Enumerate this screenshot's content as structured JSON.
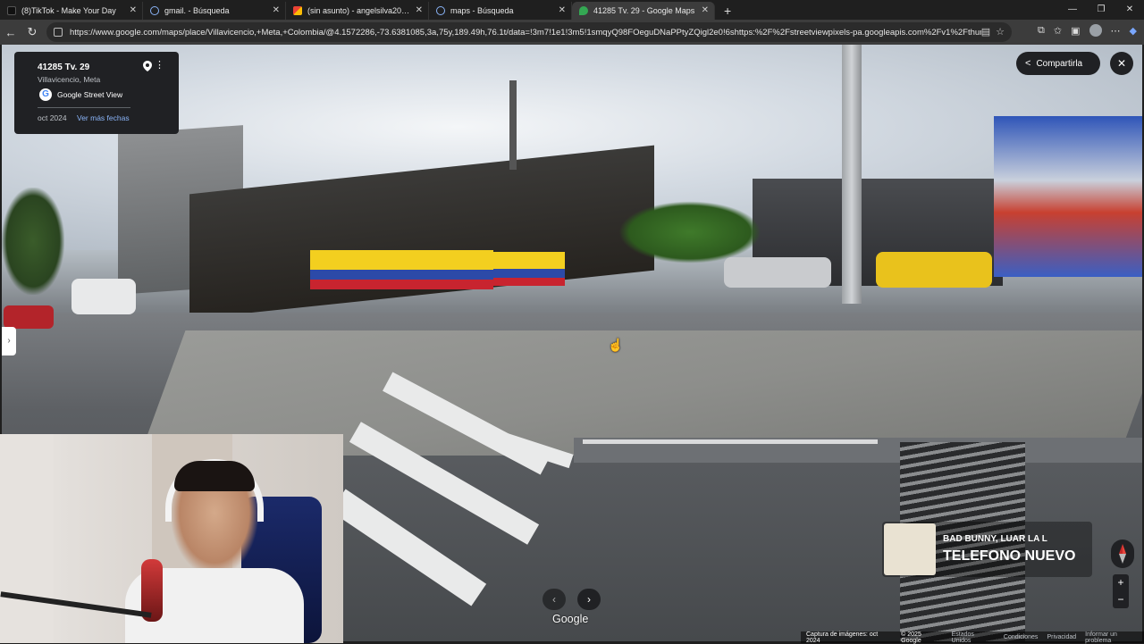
{
  "tabs": [
    {
      "label": "(8)TikTok - Make Your Day",
      "icon": "tiktok-icon",
      "color": "#111111"
    },
    {
      "label": "gmail. - Búsqueda",
      "icon": "search-icon",
      "color": "#8ab4f8"
    },
    {
      "label": "(sin asunto) - angelsilva20040419",
      "icon": "gmail-icon",
      "color": "#ea4335"
    },
    {
      "label": "maps - Búsqueda",
      "icon": "search-icon",
      "color": "#8ab4f8"
    },
    {
      "label": "41285 Tv. 29 - Google Maps",
      "icon": "maps-icon",
      "color": "#34a853",
      "active": true
    }
  ],
  "new_tab": "+",
  "window_controls": {
    "minimize": "—",
    "restore": "❐",
    "close": "✕"
  },
  "address_bar": {
    "url": "https://www.google.com/maps/place/Villavicencio,+Meta,+Colombia/@4.1572286,-73.6381085,3a,75y,189.49h,76.1t/data=!3m7!1e1!3m5!1smqyQ98FOeguDNaPPtyZQigl2e0!6shttps:%2F%2Fstreetviewpixels-pa.googleapis.com%2Fv1%2Fthumbnail%"
  },
  "info_card": {
    "title": "41285 Tv. 29",
    "subtitle": "Villavicencio, Meta",
    "source": "Google Street View",
    "date": "oct 2024",
    "more_dates": "Ver más fechas"
  },
  "share_label": "Compartirla",
  "close_label": "✕",
  "music": {
    "artist": "BAD BUNNY, LUAR LA L",
    "song": "TELEFONO NUEVO"
  },
  "google_label": "Google",
  "zoom": {
    "in": "+",
    "out": "−"
  },
  "footer": {
    "capture": "Captura de imágenes: oct 2024",
    "copyright": "© 2025 Google",
    "links": [
      "Estados Unidos",
      "Condiciones",
      "Privacidad",
      "Informar un problema"
    ]
  }
}
